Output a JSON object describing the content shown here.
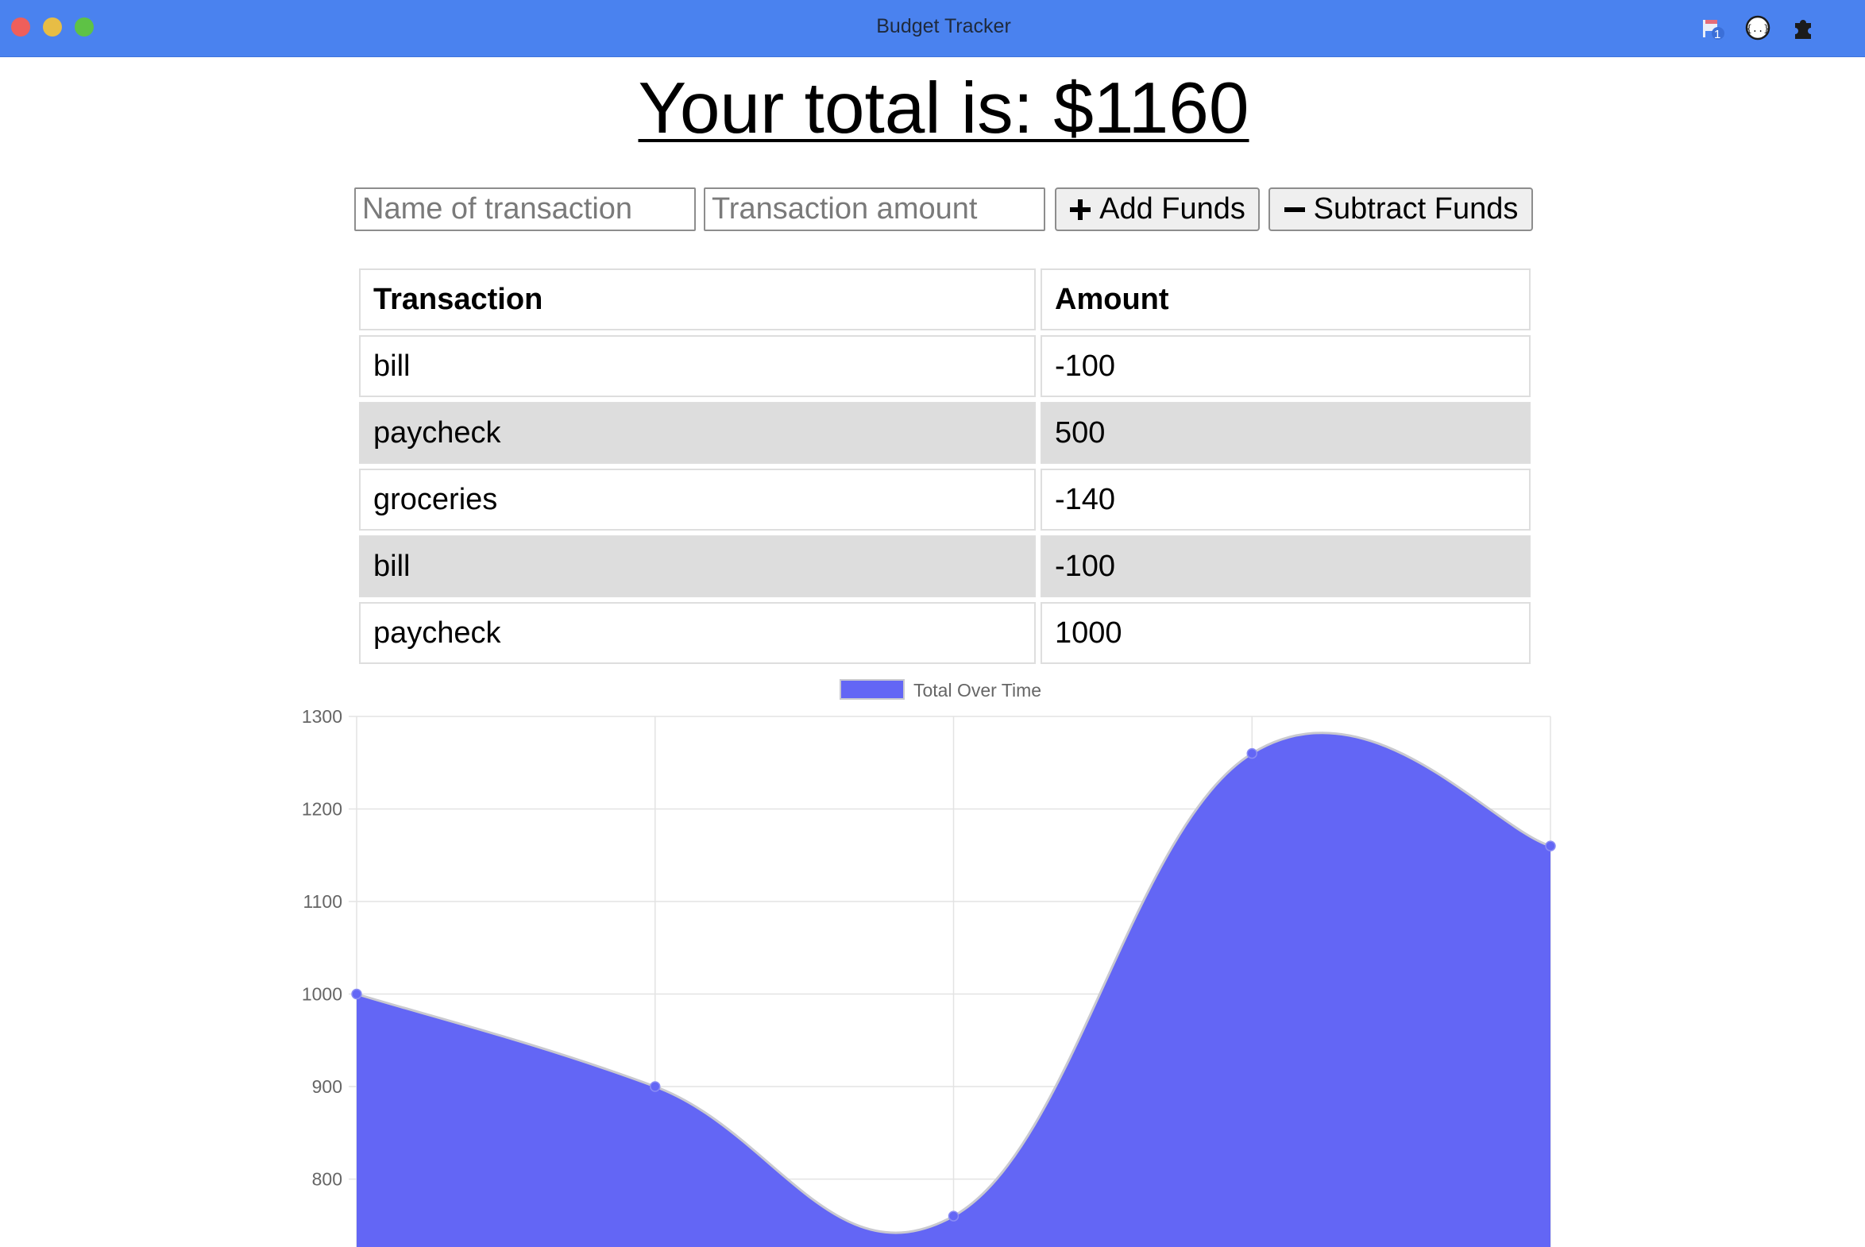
{
  "window": {
    "title": "Budget Tracker",
    "extensions": [
      {
        "icon": "flag-extension-icon",
        "badge": "1"
      },
      {
        "icon": "json-extension-icon"
      },
      {
        "icon": "puzzle-extensions-icon"
      }
    ]
  },
  "header": {
    "total_text": "Your total is: $1160"
  },
  "form": {
    "name_placeholder": "Name of transaction",
    "amount_placeholder": "Transaction amount",
    "add_label": "Add Funds",
    "subtract_label": "Subtract Funds"
  },
  "table": {
    "headers": [
      "Transaction",
      "Amount"
    ],
    "rows": [
      {
        "name": "bill",
        "amount": "-100"
      },
      {
        "name": "paycheck",
        "amount": "500"
      },
      {
        "name": "groceries",
        "amount": "-140"
      },
      {
        "name": "bill",
        "amount": "-100"
      },
      {
        "name": "paycheck",
        "amount": "1000"
      }
    ]
  },
  "colors": {
    "titlebar": "#4a82ef",
    "chart_fill": "#6366f5",
    "striped_row": "#dddddd"
  },
  "chart_data": {
    "type": "area",
    "x": [
      "",
      "",
      "",
      "",
      ""
    ],
    "series": [
      {
        "name": "Total Over Time",
        "values": [
          1000,
          900,
          760,
          1260,
          1160
        ]
      }
    ],
    "ylim": [
      700,
      1300
    ],
    "yticks": [
      800,
      900,
      1000,
      1100,
      1200,
      1300
    ],
    "legend": "top-center",
    "grid": true,
    "smooth": true
  }
}
